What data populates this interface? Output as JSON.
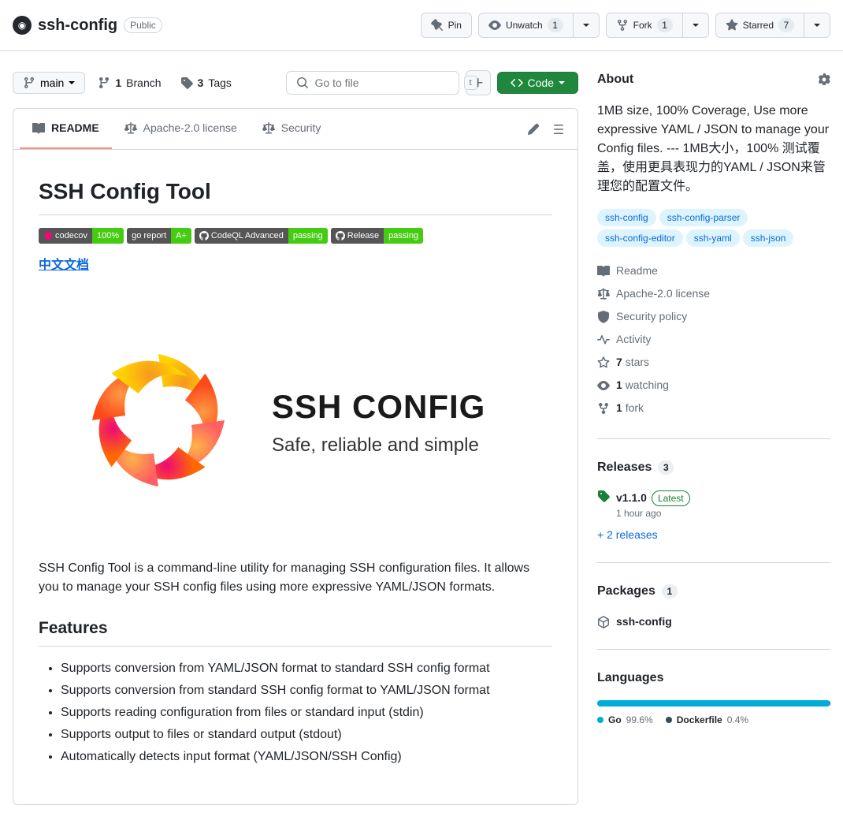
{
  "header": {
    "repo_name": "ssh-config",
    "visibility": "Public",
    "pin_label": "Pin",
    "unwatch_label": "Unwatch",
    "unwatch_count": "1",
    "fork_label": "Fork",
    "fork_count": "1",
    "starred_label": "Starred",
    "starred_count": "7"
  },
  "filenav": {
    "branch": "main",
    "branches_count": "1",
    "branches_label": "Branch",
    "tags_count": "3",
    "tags_label": "Tags",
    "search_placeholder": "Go to file",
    "search_kbd": "t",
    "code_label": "Code"
  },
  "tabs": {
    "readme": "README",
    "license": "Apache-2.0 license",
    "security": "Security"
  },
  "readme": {
    "title": "SSH Config Tool",
    "badges": [
      {
        "left": "codecov",
        "right": "100%",
        "rc": "green",
        "icon": "cov"
      },
      {
        "left": "go report",
        "right": "A+",
        "rc": "green",
        "icon": ""
      },
      {
        "left": "CodeQL Advanced",
        "right": "passing",
        "rc": "green",
        "icon": "gh"
      },
      {
        "left": "Release",
        "right": "passing",
        "rc": "green",
        "icon": "gh"
      }
    ],
    "cn_link": "中文文档",
    "brand": "SSH CONFIG",
    "tagline": "Safe, reliable and simple",
    "intro": "SSH Config Tool is a command-line utility for managing SSH configuration files. It allows you to manage your SSH config files using more expressive YAML/JSON formats.",
    "features_heading": "Features",
    "features": [
      "Supports conversion from YAML/JSON format to standard SSH config format",
      "Supports conversion from standard SSH config format to YAML/JSON format",
      "Supports reading configuration from files or standard input (stdin)",
      "Supports output to files or standard output (stdout)",
      "Automatically detects input format (YAML/JSON/SSH Config)"
    ]
  },
  "about": {
    "heading": "About",
    "description": "1MB size, 100% Coverage, Use more expressive YAML / JSON to manage your Config files. --- 1MB大小，100% 测试覆盖，使用更具表现力的YAML / JSON来管理您的配置文件。",
    "topics": [
      "ssh-config",
      "ssh-config-parser",
      "ssh-config-editor",
      "ssh-yaml",
      "ssh-json"
    ],
    "meta": {
      "readme": "Readme",
      "license": "Apache-2.0 license",
      "security": "Security policy",
      "activity": "Activity",
      "stars_count": "7",
      "stars_label": "stars",
      "watching_count": "1",
      "watching_label": "watching",
      "forks_count": "1",
      "forks_label": "fork"
    }
  },
  "releases": {
    "heading": "Releases",
    "count": "3",
    "latest_tag": "v1.1.0",
    "latest_label": "Latest",
    "latest_time": "1 hour ago",
    "more": "+ 2 releases"
  },
  "packages": {
    "heading": "Packages",
    "count": "1",
    "name": "ssh-config"
  },
  "languages": {
    "heading": "Languages",
    "items": [
      {
        "name": "Go",
        "pct": "99.6%",
        "color": "#00ADD8"
      },
      {
        "name": "Dockerfile",
        "pct": "0.4%",
        "color": "#384d54"
      }
    ]
  }
}
